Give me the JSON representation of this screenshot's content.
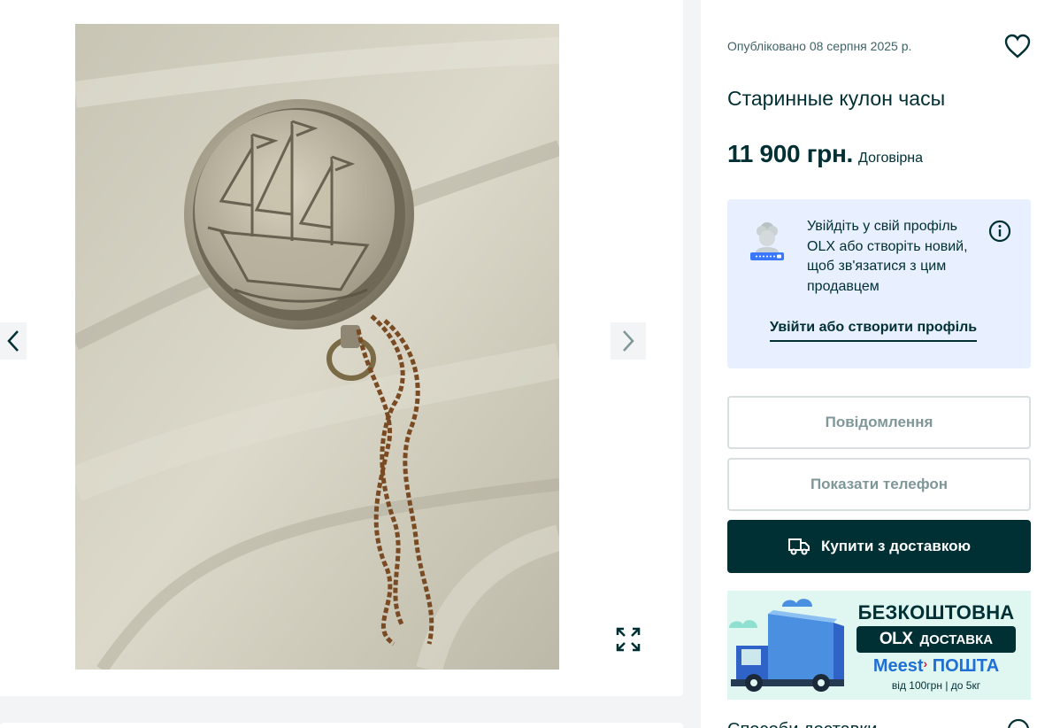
{
  "listing": {
    "posted": "Опубліковано 08 серпня 2025 р.",
    "title": "Старинные кулон часы",
    "price": "11 900 грн.",
    "price_note": "Договірна"
  },
  "login_prompt": {
    "text": "Увійдіть у свій профіль OLX або створіть новий, щоб зв'язатися з цим продавцем",
    "link": "Увійти або створити профіль"
  },
  "actions": {
    "message": "Повідомлення",
    "phone": "Показати телефон",
    "buy": "Купити з доставкою"
  },
  "promo": {
    "headline": "БЕЗКОШТОВНА",
    "brand": "OLX",
    "delivery": "ДОСТАВКА",
    "partner_a": "Meest",
    "partner_b": "ПОШТА",
    "terms": "від 100грн | до 5кг"
  },
  "delivery_section": {
    "title": "Способи доставки"
  },
  "icons": {
    "prev": "chevron-left-icon",
    "next": "chevron-right-icon",
    "fullscreen": "expand-icon",
    "favorite": "heart-icon",
    "info": "info-icon",
    "truck": "truck-icon"
  },
  "colors": {
    "primary": "#002f34",
    "login_bg": "#e8effe",
    "promo_bg": "#dff6f1",
    "truck_blue": "#3a7bd5"
  }
}
